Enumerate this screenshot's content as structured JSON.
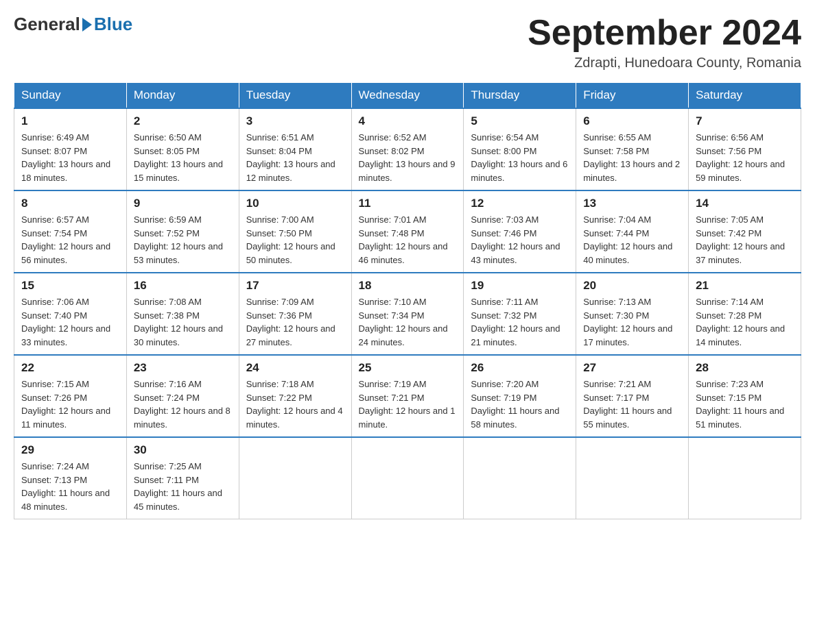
{
  "header": {
    "logo_general": "General",
    "logo_blue": "Blue",
    "month_title": "September 2024",
    "location": "Zdrapti, Hunedoara County, Romania"
  },
  "days_of_week": [
    "Sunday",
    "Monday",
    "Tuesday",
    "Wednesday",
    "Thursday",
    "Friday",
    "Saturday"
  ],
  "weeks": [
    [
      {
        "day": "1",
        "sunrise": "6:49 AM",
        "sunset": "8:07 PM",
        "daylight": "13 hours and 18 minutes."
      },
      {
        "day": "2",
        "sunrise": "6:50 AM",
        "sunset": "8:05 PM",
        "daylight": "13 hours and 15 minutes."
      },
      {
        "day": "3",
        "sunrise": "6:51 AM",
        "sunset": "8:04 PM",
        "daylight": "13 hours and 12 minutes."
      },
      {
        "day": "4",
        "sunrise": "6:52 AM",
        "sunset": "8:02 PM",
        "daylight": "13 hours and 9 minutes."
      },
      {
        "day": "5",
        "sunrise": "6:54 AM",
        "sunset": "8:00 PM",
        "daylight": "13 hours and 6 minutes."
      },
      {
        "day": "6",
        "sunrise": "6:55 AM",
        "sunset": "7:58 PM",
        "daylight": "13 hours and 2 minutes."
      },
      {
        "day": "7",
        "sunrise": "6:56 AM",
        "sunset": "7:56 PM",
        "daylight": "12 hours and 59 minutes."
      }
    ],
    [
      {
        "day": "8",
        "sunrise": "6:57 AM",
        "sunset": "7:54 PM",
        "daylight": "12 hours and 56 minutes."
      },
      {
        "day": "9",
        "sunrise": "6:59 AM",
        "sunset": "7:52 PM",
        "daylight": "12 hours and 53 minutes."
      },
      {
        "day": "10",
        "sunrise": "7:00 AM",
        "sunset": "7:50 PM",
        "daylight": "12 hours and 50 minutes."
      },
      {
        "day": "11",
        "sunrise": "7:01 AM",
        "sunset": "7:48 PM",
        "daylight": "12 hours and 46 minutes."
      },
      {
        "day": "12",
        "sunrise": "7:03 AM",
        "sunset": "7:46 PM",
        "daylight": "12 hours and 43 minutes."
      },
      {
        "day": "13",
        "sunrise": "7:04 AM",
        "sunset": "7:44 PM",
        "daylight": "12 hours and 40 minutes."
      },
      {
        "day": "14",
        "sunrise": "7:05 AM",
        "sunset": "7:42 PM",
        "daylight": "12 hours and 37 minutes."
      }
    ],
    [
      {
        "day": "15",
        "sunrise": "7:06 AM",
        "sunset": "7:40 PM",
        "daylight": "12 hours and 33 minutes."
      },
      {
        "day": "16",
        "sunrise": "7:08 AM",
        "sunset": "7:38 PM",
        "daylight": "12 hours and 30 minutes."
      },
      {
        "day": "17",
        "sunrise": "7:09 AM",
        "sunset": "7:36 PM",
        "daylight": "12 hours and 27 minutes."
      },
      {
        "day": "18",
        "sunrise": "7:10 AM",
        "sunset": "7:34 PM",
        "daylight": "12 hours and 24 minutes."
      },
      {
        "day": "19",
        "sunrise": "7:11 AM",
        "sunset": "7:32 PM",
        "daylight": "12 hours and 21 minutes."
      },
      {
        "day": "20",
        "sunrise": "7:13 AM",
        "sunset": "7:30 PM",
        "daylight": "12 hours and 17 minutes."
      },
      {
        "day": "21",
        "sunrise": "7:14 AM",
        "sunset": "7:28 PM",
        "daylight": "12 hours and 14 minutes."
      }
    ],
    [
      {
        "day": "22",
        "sunrise": "7:15 AM",
        "sunset": "7:26 PM",
        "daylight": "12 hours and 11 minutes."
      },
      {
        "day": "23",
        "sunrise": "7:16 AM",
        "sunset": "7:24 PM",
        "daylight": "12 hours and 8 minutes."
      },
      {
        "day": "24",
        "sunrise": "7:18 AM",
        "sunset": "7:22 PM",
        "daylight": "12 hours and 4 minutes."
      },
      {
        "day": "25",
        "sunrise": "7:19 AM",
        "sunset": "7:21 PM",
        "daylight": "12 hours and 1 minute."
      },
      {
        "day": "26",
        "sunrise": "7:20 AM",
        "sunset": "7:19 PM",
        "daylight": "11 hours and 58 minutes."
      },
      {
        "day": "27",
        "sunrise": "7:21 AM",
        "sunset": "7:17 PM",
        "daylight": "11 hours and 55 minutes."
      },
      {
        "day": "28",
        "sunrise": "7:23 AM",
        "sunset": "7:15 PM",
        "daylight": "11 hours and 51 minutes."
      }
    ],
    [
      {
        "day": "29",
        "sunrise": "7:24 AM",
        "sunset": "7:13 PM",
        "daylight": "11 hours and 48 minutes."
      },
      {
        "day": "30",
        "sunrise": "7:25 AM",
        "sunset": "7:11 PM",
        "daylight": "11 hours and 45 minutes."
      },
      null,
      null,
      null,
      null,
      null
    ]
  ]
}
